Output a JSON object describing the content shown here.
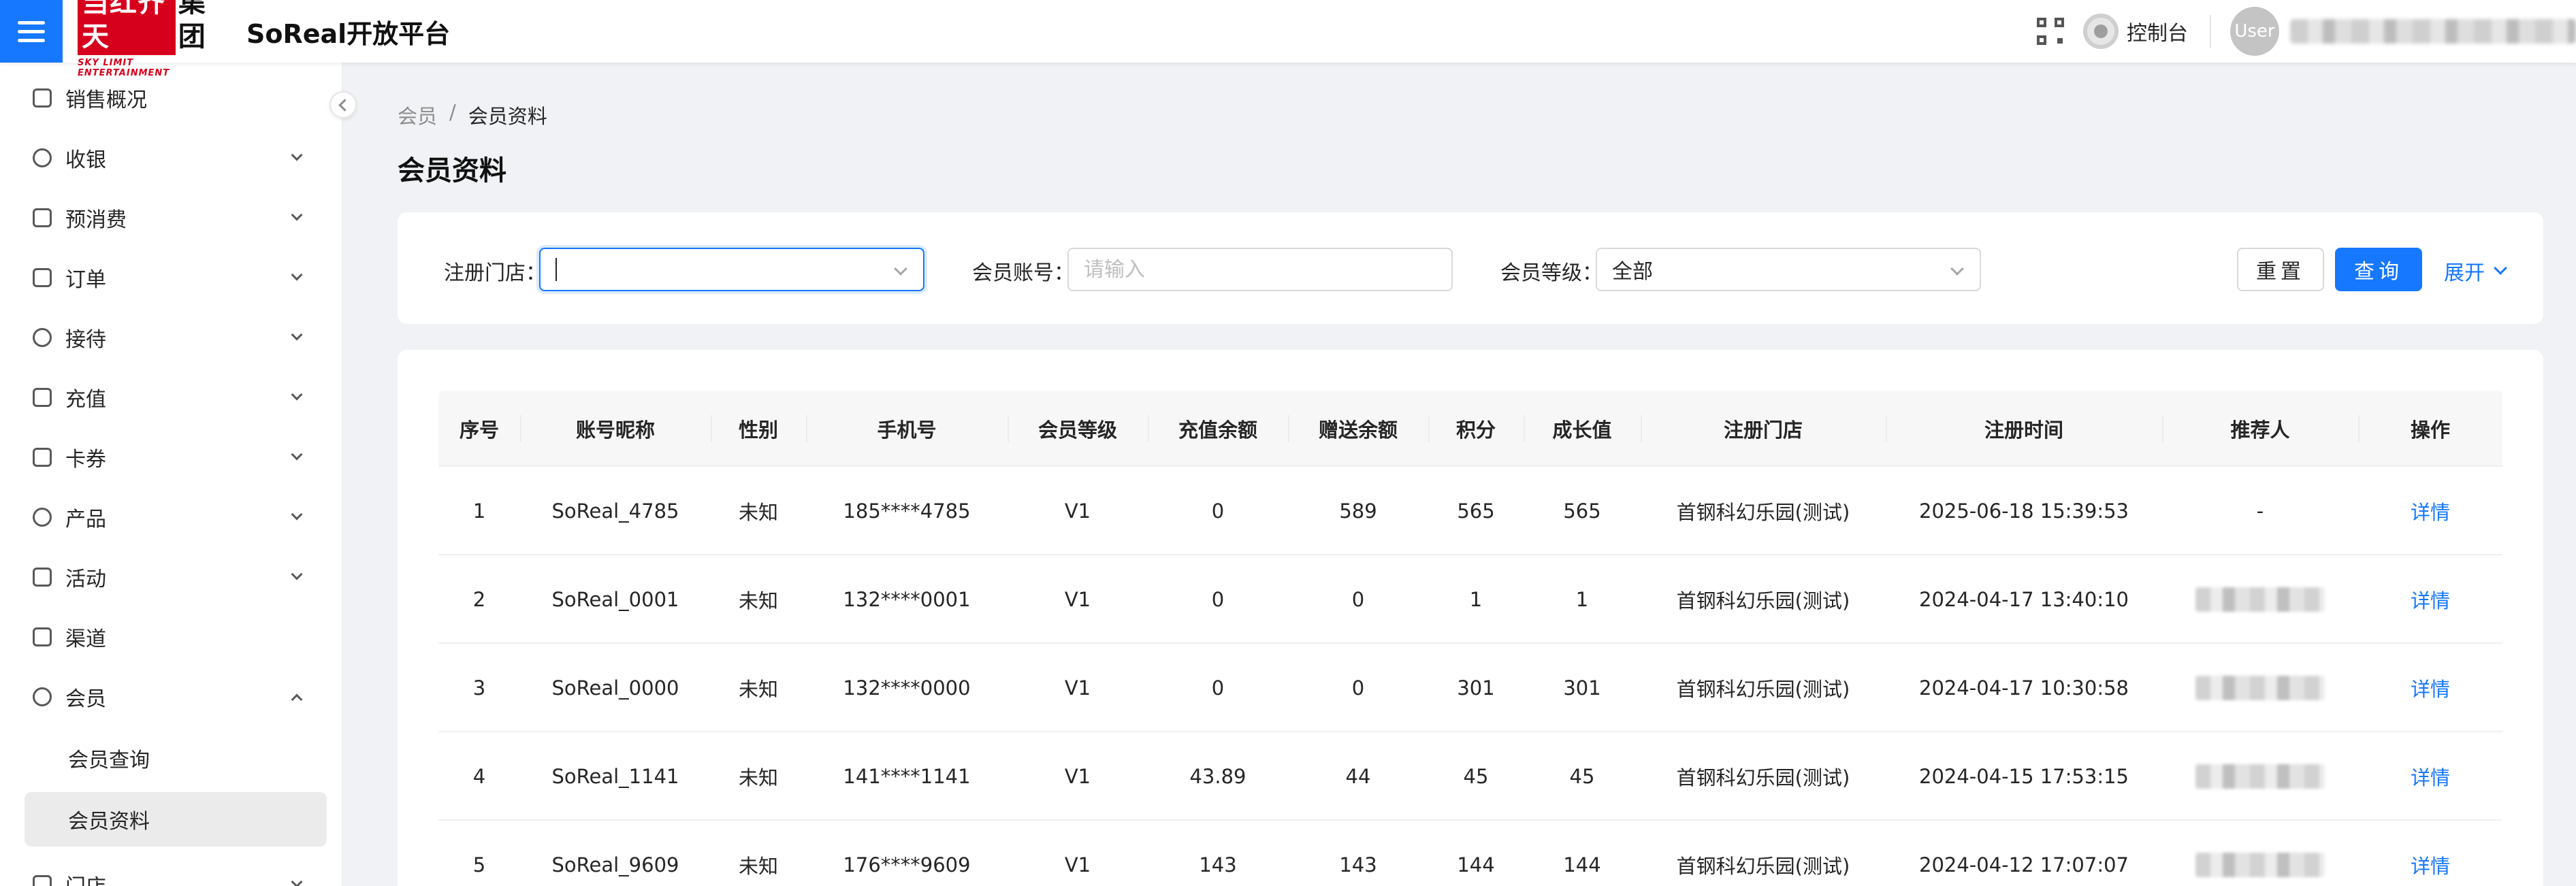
{
  "header": {
    "logo_main_red": "当红齐天",
    "logo_main_black": "集团",
    "logo_sub": "SKY LIMIT ENTERTAINMENT",
    "app_title": "SoReal开放平台",
    "console_label": "控制台",
    "avatar_text": "User"
  },
  "sidebar": {
    "items": [
      {
        "label": "销售概况",
        "icon": "dashboard-icon"
      },
      {
        "label": "收银",
        "icon": "shield-icon"
      },
      {
        "label": "预消费",
        "icon": "folder-icon"
      },
      {
        "label": "订单",
        "icon": "file-icon"
      },
      {
        "label": "接待",
        "icon": "user-icon"
      },
      {
        "label": "充值",
        "icon": "yuan-icon"
      },
      {
        "label": "卡券",
        "icon": "card-icon"
      },
      {
        "label": "产品",
        "icon": "product-icon"
      },
      {
        "label": "活动",
        "icon": "activity-icon"
      },
      {
        "label": "渠道",
        "icon": "channel-icon"
      },
      {
        "label": "会员",
        "icon": "member-icon"
      },
      {
        "label": "门店",
        "icon": "store-icon"
      }
    ],
    "member_sub": [
      "会员查询",
      "会员资料"
    ]
  },
  "breadcrumb": {
    "parent": "会员",
    "separator": "/",
    "current": "会员资料"
  },
  "page_title": "会员资料",
  "filters": {
    "store_label": "注册门店：",
    "store_value": "",
    "account_label": "会员账号：",
    "account_placeholder": "请输入",
    "level_label": "会员等级：",
    "level_value": "全部",
    "reset_label": "重置",
    "query_label": "查询",
    "expand_label": "展开"
  },
  "table": {
    "headers": [
      "序号",
      "账号昵称",
      "性别",
      "手机号",
      "会员等级",
      "充值余额",
      "赠送余额",
      "积分",
      "成长值",
      "注册门店",
      "注册时间",
      "推荐人",
      "操作"
    ],
    "rows": [
      {
        "idx": "1",
        "nick": "SoReal_4785",
        "gender": "未知",
        "phone": "185****4785",
        "level": "V1",
        "recharge": "0",
        "gift": "589",
        "points": "565",
        "growth": "565",
        "store": "首钢科幻乐园(测试)",
        "time": "2025-06-18 15:39:53",
        "referrer": "-",
        "action": "详情"
      },
      {
        "idx": "2",
        "nick": "SoReal_0001",
        "gender": "未知",
        "phone": "132****0001",
        "level": "V1",
        "recharge": "0",
        "gift": "0",
        "points": "1",
        "growth": "1",
        "store": "首钢科幻乐园(测试)",
        "time": "2024-04-17 13:40:10",
        "referrer": "",
        "action": "详情"
      },
      {
        "idx": "3",
        "nick": "SoReal_0000",
        "gender": "未知",
        "phone": "132****0000",
        "level": "V1",
        "recharge": "0",
        "gift": "0",
        "points": "301",
        "growth": "301",
        "store": "首钢科幻乐园(测试)",
        "time": "2024-04-17 10:30:58",
        "referrer": "",
        "action": "详情"
      },
      {
        "idx": "4",
        "nick": "SoReal_1141",
        "gender": "未知",
        "phone": "141****1141",
        "level": "V1",
        "recharge": "43.89",
        "gift": "44",
        "points": "45",
        "growth": "45",
        "store": "首钢科幻乐园(测试)",
        "time": "2024-04-15 17:53:15",
        "referrer": "",
        "action": "详情"
      },
      {
        "idx": "5",
        "nick": "SoReal_9609",
        "gender": "未知",
        "phone": "176****9609",
        "level": "V1",
        "recharge": "143",
        "gift": "143",
        "points": "144",
        "growth": "144",
        "store": "首钢科幻乐园(测试)",
        "time": "2024-04-12 17:07:07",
        "referrer": "",
        "action": "详情"
      }
    ]
  },
  "colors": {
    "primary": "#1677ff",
    "brand_red": "#d6001c"
  }
}
